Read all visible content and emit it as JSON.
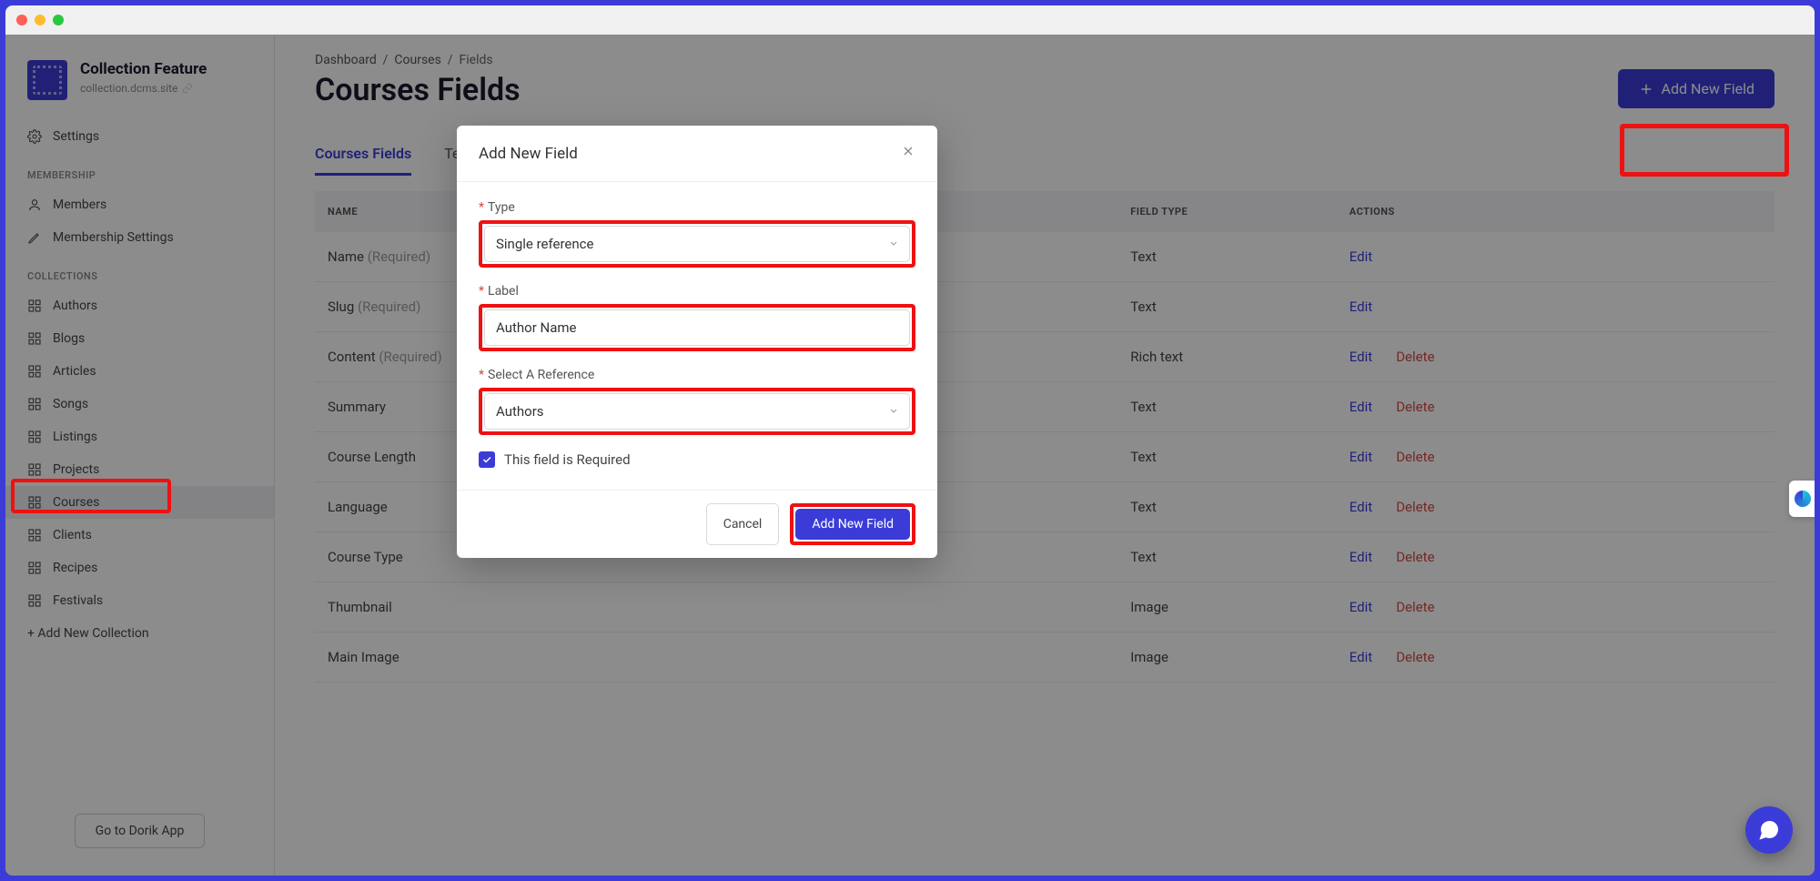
{
  "brand": {
    "title": "Collection Feature",
    "subtitle": "collection.dcms.site"
  },
  "sidebar": {
    "settings": "Settings",
    "section_membership": "MEMBERSHIP",
    "members": "Members",
    "membership_settings": "Membership Settings",
    "section_collections": "COLLECTIONS",
    "collections": [
      "Authors",
      "Blogs",
      "Articles",
      "Songs",
      "Listings",
      "Projects",
      "Courses",
      "Clients",
      "Recipes",
      "Festivals"
    ],
    "add_collection": "+ Add New Collection",
    "goto_app": "Go to Dorik App"
  },
  "breadcrumb": [
    "Dashboard",
    "Courses",
    "Fields"
  ],
  "page_title": "Courses Fields",
  "add_button": "Add New Field",
  "tabs": [
    "Courses Fields",
    "Templates"
  ],
  "table": {
    "headers": [
      "NAME",
      "FIELD TYPE",
      "ACTIONS"
    ],
    "rows": [
      {
        "name": "Name",
        "required": true,
        "type": "Text",
        "delete": false
      },
      {
        "name": "Slug",
        "required": true,
        "type": "Text",
        "delete": false
      },
      {
        "name": "Content",
        "required": true,
        "type": "Rich text",
        "delete": true
      },
      {
        "name": "Summary",
        "required": false,
        "type": "Text",
        "delete": true
      },
      {
        "name": "Course Length",
        "required": false,
        "type": "Text",
        "delete": true
      },
      {
        "name": "Language",
        "required": false,
        "type": "Text",
        "delete": true
      },
      {
        "name": "Course Type",
        "required": false,
        "type": "Text",
        "delete": true
      },
      {
        "name": "Thumbnail",
        "required": false,
        "type": "Image",
        "delete": true
      },
      {
        "name": "Main Image",
        "required": false,
        "type": "Image",
        "delete": true
      }
    ],
    "required_label": "(Required)",
    "edit_label": "Edit",
    "delete_label": "Delete"
  },
  "modal": {
    "title": "Add New Field",
    "type_label": "Type",
    "type_value": "Single reference",
    "label_label": "Label",
    "label_value": "Author Name",
    "ref_label": "Select A Reference",
    "ref_value": "Authors",
    "required_label": "This field is Required",
    "cancel": "Cancel",
    "submit": "Add New Field"
  }
}
